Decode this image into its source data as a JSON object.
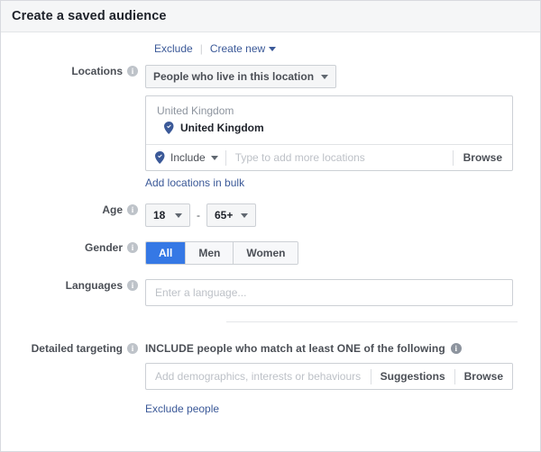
{
  "window": {
    "title": "Create a saved audience"
  },
  "top_links": {
    "exclude": "Exclude",
    "create_new": "Create new"
  },
  "locations": {
    "label": "Locations",
    "type_select": "People who live in this location",
    "group_header": "United Kingdom",
    "entry": "United Kingdom",
    "include_label": "Include",
    "input_placeholder": "Type to add more locations",
    "browse": "Browse",
    "bulk_link": "Add locations in bulk"
  },
  "age": {
    "label": "Age",
    "min": "18",
    "max": "65+",
    "dash": "-"
  },
  "gender": {
    "label": "Gender",
    "options": [
      {
        "label": "All",
        "selected": true
      },
      {
        "label": "Men",
        "selected": false
      },
      {
        "label": "Women",
        "selected": false
      }
    ]
  },
  "languages": {
    "label": "Languages",
    "placeholder": "Enter a language...",
    "value": ""
  },
  "detailed_targeting": {
    "label": "Detailed targeting",
    "heading": "INCLUDE people who match at least ONE of the following",
    "placeholder": "Add demographics, interests or behaviours",
    "value": "",
    "suggestions": "Suggestions",
    "browse": "Browse",
    "exclude_link": "Exclude people"
  },
  "icons": {
    "info": "i",
    "location_pin": "map-pin-icon",
    "chevron_down": "chevron-down-icon"
  },
  "colors": {
    "accent_blue": "#3578e5",
    "link_blue": "#3b5998",
    "header_bg": "#f5f6f7",
    "border": "#ccd0d5",
    "label_text": "#4b4f56"
  }
}
